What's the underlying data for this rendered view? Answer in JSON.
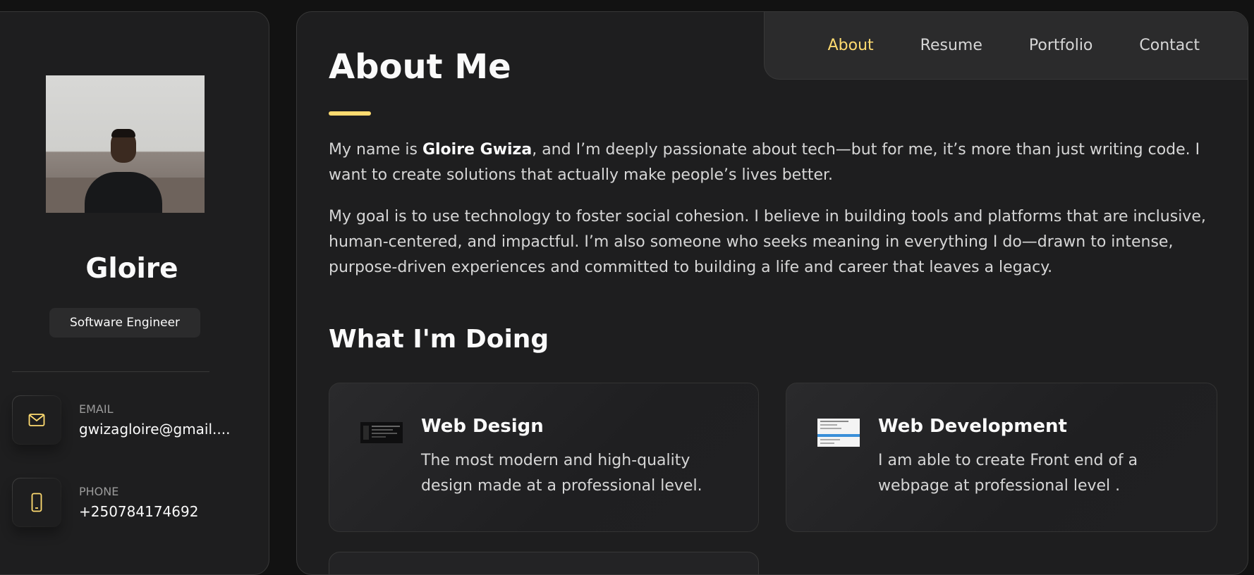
{
  "sidebar": {
    "name": "Gloire",
    "job_title": "Software Engineer",
    "contacts": [
      {
        "label": "EMAIL",
        "value": "gwizagloire@gmail....",
        "icon": "mail-icon"
      },
      {
        "label": "PHONE",
        "value": "+250784174692",
        "icon": "phone-icon"
      }
    ]
  },
  "nav": {
    "items": [
      {
        "label": "About",
        "active": true
      },
      {
        "label": "Resume",
        "active": false
      },
      {
        "label": "Portfolio",
        "active": false
      },
      {
        "label": "Contact",
        "active": false
      }
    ]
  },
  "about": {
    "title": "About Me",
    "para1_prefix": "My name is ",
    "para1_name": "Gloire Gwiza",
    "para1_suffix": ", and I’m deeply passionate about tech—but for me, it’s more than just writing code. I want to create solutions that actually make people’s lives better.",
    "para2": "My goal is to use technology to foster social cohesion. I believe in building tools and platforms that are inclusive, human-centered, and impactful. I’m also someone who seeks meaning in everything I do—drawn to intense, purpose-driven experiences and committed to building a life and career that leaves a legacy."
  },
  "services": {
    "title": "What I'm Doing",
    "items": [
      {
        "title": "Web Design",
        "text": "The most modern and high-quality design made at a professional level."
      },
      {
        "title": "Web Development",
        "text": "I am able to create Front end of a webpage at professional level ."
      }
    ]
  },
  "colors": {
    "accent": "#ffdb70",
    "background": "#121212",
    "card": "#1e1e1f"
  }
}
